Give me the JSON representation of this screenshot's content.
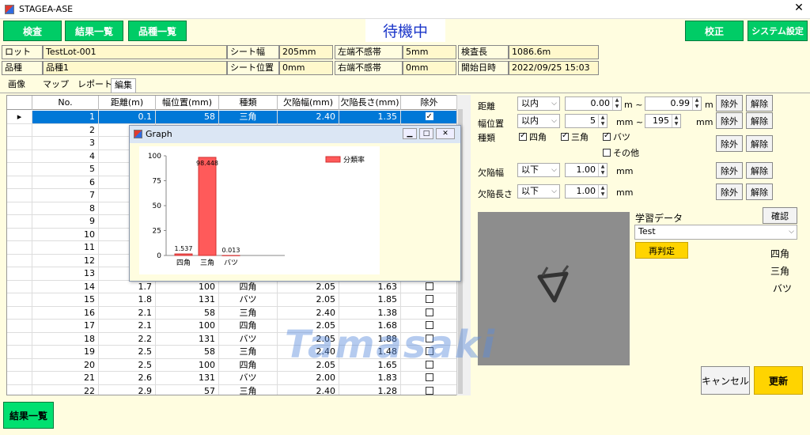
{
  "window": {
    "title": "STAGEA-ASE",
    "close_glyph": "✕"
  },
  "toolbar": {
    "inspect": "検査",
    "result_list": "結果一覧",
    "product_list": "品種一覧",
    "status": "待機中",
    "calibrate": "校正",
    "system_settings": "システム設定"
  },
  "info": {
    "lot_label": "ロットNo.",
    "lot_value": "TestLot-001",
    "sheet_width_label": "シート幅",
    "sheet_width_value": "205mm",
    "left_zone_label": "左端不感帯",
    "left_zone_value": "5mm",
    "length_label": "検査長",
    "length_value": "1086.6m",
    "product_label": "品種",
    "product_value": "品種1",
    "sheet_pos_label": "シート位置",
    "sheet_pos_value": "0mm",
    "right_zone_label": "右端不感帯",
    "right_zone_value": "0mm",
    "start_label": "開始日時",
    "start_value": "2022/09/25 15:03"
  },
  "tabs": [
    "画像",
    "マップ",
    "レポート",
    "編集"
  ],
  "grid": {
    "headers": [
      "No.",
      "距離(m)",
      "幅位置(mm)",
      "種類",
      "欠陥幅(mm)",
      "欠陥長さ(mm)",
      "除外"
    ],
    "rows": [
      [
        "1",
        "0.1",
        "58",
        "三角",
        "2.40",
        "1.35",
        true
      ],
      [
        "2",
        "",
        "",
        "",
        "",
        "",
        false
      ],
      [
        "3",
        "",
        "",
        "",
        "",
        "",
        false
      ],
      [
        "4",
        "",
        "",
        "",
        "",
        "",
        false
      ],
      [
        "5",
        "",
        "",
        "",
        "",
        "",
        false
      ],
      [
        "6",
        "",
        "",
        "",
        "",
        "",
        false
      ],
      [
        "7",
        "",
        "",
        "",
        "",
        "",
        false
      ],
      [
        "8",
        "",
        "",
        "",
        "",
        "",
        false
      ],
      [
        "9",
        "",
        "",
        "",
        "",
        "",
        false
      ],
      [
        "10",
        "",
        "",
        "",
        "",
        "",
        false
      ],
      [
        "11",
        "",
        "",
        "",
        "",
        "",
        false
      ],
      [
        "12",
        "",
        "",
        "",
        "",
        "",
        false
      ],
      [
        "13",
        "",
        "",
        "",
        "",
        "",
        false
      ],
      [
        "14",
        "1.7",
        "100",
        "四角",
        "2.05",
        "1.63",
        false
      ],
      [
        "15",
        "1.8",
        "131",
        "バツ",
        "2.05",
        "1.85",
        false
      ],
      [
        "16",
        "2.1",
        "58",
        "三角",
        "2.40",
        "1.38",
        false
      ],
      [
        "17",
        "2.1",
        "100",
        "四角",
        "2.05",
        "1.68",
        false
      ],
      [
        "18",
        "2.2",
        "131",
        "バツ",
        "2.05",
        "1.88",
        false
      ],
      [
        "19",
        "2.5",
        "58",
        "三角",
        "2.40",
        "1.48",
        false
      ],
      [
        "20",
        "2.5",
        "100",
        "四角",
        "2.05",
        "1.65",
        false
      ],
      [
        "21",
        "2.6",
        "131",
        "バツ",
        "2.00",
        "1.83",
        false
      ],
      [
        "22",
        "2.9",
        "57",
        "三角",
        "2.40",
        "1.28",
        false
      ]
    ]
  },
  "graph": {
    "title": "Graph",
    "chart_data": {
      "type": "bar",
      "categories": [
        "四角",
        "三角",
        "バツ"
      ],
      "series": [
        {
          "name": "分類率",
          "values": [
            1.537,
            98.448,
            0.013
          ]
        }
      ],
      "value_labels": [
        "1.537",
        "98.448",
        "0.013"
      ],
      "ylim": [
        0,
        100
      ],
      "yticks": [
        "0",
        "25",
        "50",
        "75",
        "100"
      ],
      "legend": "top-right",
      "color": "#ff5a5a"
    }
  },
  "filters": {
    "distance_label": "距離",
    "distance_cond": "以内",
    "distance_min": "0.00",
    "distance_unit1": "m ~",
    "distance_max": "0.99",
    "distance_unit2": "m",
    "width_label": "幅位置",
    "width_cond": "以内",
    "width_min": "5",
    "width_unit1": "mm ~",
    "width_max": "195",
    "width_unit2": "mm",
    "type_label": "種類",
    "type_square": "四角",
    "type_triangle": "三角",
    "type_x": "バツ",
    "type_other": "その他",
    "dwidth_label": "欠陥幅",
    "dwidth_cond": "以下",
    "dwidth_value": "1.00",
    "dwidth_unit": "mm",
    "dlength_label": "欠陥長さ",
    "dlength_cond": "以下",
    "dlength_value": "1.00",
    "dlength_unit": "mm",
    "exclude": "除外",
    "release": "解除"
  },
  "learning": {
    "label": "学習データ",
    "confirm": "確認",
    "dataset": "Test",
    "rejudge": "再判定",
    "classes": [
      "四角",
      "三角",
      "バツ"
    ]
  },
  "actions": {
    "cancel": "キャンセル",
    "update": "更新",
    "result_list_bottom": "結果一覧"
  },
  "watermark": "Tamasaki",
  "colors": {
    "green": "#00cc66",
    "accent_yellow": "#ffd400",
    "selection": "#0078d7"
  }
}
